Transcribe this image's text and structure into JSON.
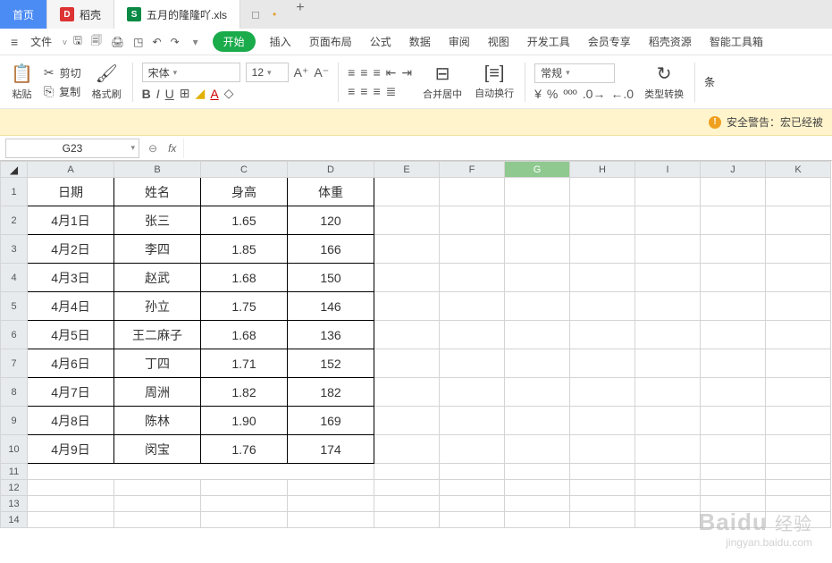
{
  "tabs": {
    "home": "首页",
    "doke": "稻壳",
    "file": "五月的隆隆吖.xls"
  },
  "menubar": {
    "file": "三 文件 v",
    "start": "开始",
    "insert": "插入",
    "layout": "页面布局",
    "formula": "公式",
    "data": "数据",
    "review": "审阅",
    "view": "视图",
    "dev": "开发工具",
    "member": "会员专享",
    "res": "稻壳资源",
    "tools": "智能工具箱"
  },
  "ribbon": {
    "paste": "粘贴",
    "cut": "剪切",
    "copy": "复制",
    "format_painter": "格式刷",
    "font_name": "宋体",
    "font_size": "12",
    "merge": "合并居中",
    "wrap": "自动换行",
    "numfmt": "常规",
    "typeconv": "类型转换",
    "cond": "条"
  },
  "warnbar": {
    "text": "安全警告：宏已经被"
  },
  "fbar": {
    "cell": "G23",
    "fx": "fx"
  },
  "columns": [
    "A",
    "B",
    "C",
    "D",
    "E",
    "F",
    "G",
    "H",
    "I",
    "J",
    "K"
  ],
  "headers": {
    "date": "日期",
    "name": "姓名",
    "height": "身高",
    "weight": "体重"
  },
  "chart_data": {
    "type": "table",
    "columns": [
      "日期",
      "姓名",
      "身高",
      "体重"
    ],
    "rows": [
      {
        "d": "4月1日",
        "n": "张三",
        "h": "1.65",
        "w": "120"
      },
      {
        "d": "4月2日",
        "n": "李四",
        "h": "1.85",
        "w": "166"
      },
      {
        "d": "4月3日",
        "n": "赵武",
        "h": "1.68",
        "w": "150"
      },
      {
        "d": "4月4日",
        "n": "孙立",
        "h": "1.75",
        "w": "146"
      },
      {
        "d": "4月5日",
        "n": "王二麻子",
        "h": "1.68",
        "w": "136"
      },
      {
        "d": "4月6日",
        "n": "丁四",
        "h": "1.71",
        "w": "152"
      },
      {
        "d": "4月7日",
        "n": "周洲",
        "h": "1.82",
        "w": "182"
      },
      {
        "d": "4月8日",
        "n": "陈林",
        "h": "1.90",
        "w": "169"
      },
      {
        "d": "4月9日",
        "n": "闵宝",
        "h": "1.76",
        "w": "174"
      }
    ]
  },
  "watermark": {
    "brand_a": "Bai",
    "brand_b": "du",
    "brand_c": "经验",
    "url": "jingyan.baidu.com"
  }
}
